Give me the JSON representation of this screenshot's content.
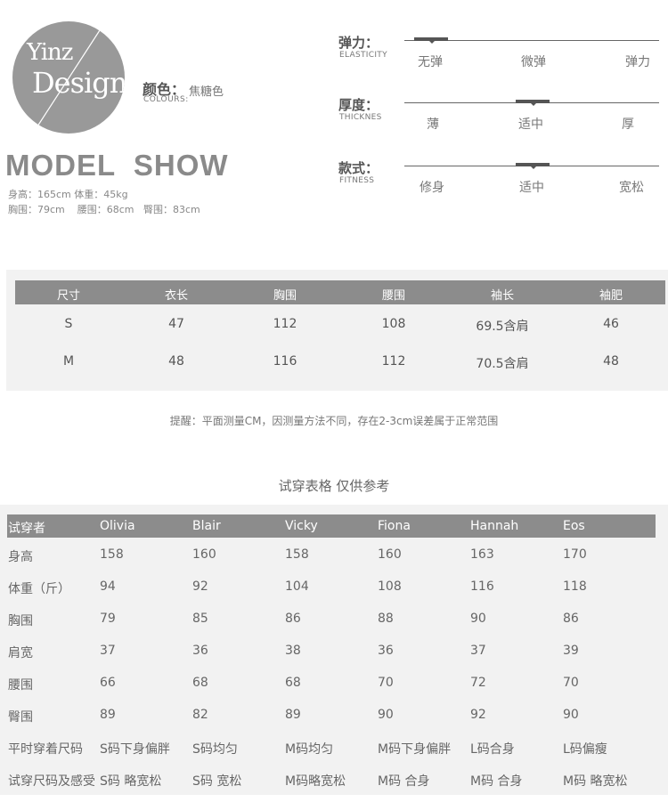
{
  "logo": {
    "line1": "Yinz",
    "line2": "Design"
  },
  "color": {
    "label": "颜色：",
    "value": "焦糖色",
    "label_en": "COLOURS:"
  },
  "model_show": {
    "title": "MODEL  SHOW",
    "line1": "身高：165cm 体重：45kg",
    "line2": "胸围：79cm    腰围：68cm   臀围：83cm"
  },
  "sliders": [
    {
      "label": "弹力：",
      "label_en": "ELASTICITY",
      "options": [
        "无弹",
        "微弹",
        "弹力"
      ],
      "selected": "无弹"
    },
    {
      "label": "厚度：",
      "label_en": "THICKNES",
      "options": [
        "薄",
        "适中",
        "厚"
      ],
      "selected": "适中"
    },
    {
      "label": "款式：",
      "label_en": "FITNESS",
      "options": [
        "修身",
        "适中",
        "宽松"
      ],
      "selected": "适中"
    }
  ],
  "size_table": {
    "headers": [
      "尺寸",
      "衣长",
      "胸围",
      "腰围",
      "袖长",
      "袖肥"
    ],
    "rows": [
      [
        "S",
        "47",
        "112",
        "108",
        "69.5含肩",
        "46"
      ],
      [
        "M",
        "48",
        "116",
        "112",
        "70.5含肩",
        "48"
      ]
    ]
  },
  "note": "提醒：平面测量CM，因测量方法不同，存在2-3cm误差属于正常范围",
  "trial_table": {
    "title": "试穿表格 仅供参考",
    "headers": [
      "试穿者",
      "Olivia",
      "Blair",
      "Vicky",
      "Fiona",
      "Hannah",
      "Eos"
    ],
    "rows": [
      [
        "身高",
        "158",
        "160",
        "158",
        "160",
        "163",
        "170"
      ],
      [
        "体重（斤）",
        "94",
        "92",
        "104",
        "108",
        "116",
        "118"
      ],
      [
        "胸围",
        "79",
        "85",
        "86",
        "88",
        "90",
        "86"
      ],
      [
        "肩宽",
        "37",
        "36",
        "38",
        "36",
        "37",
        "39"
      ],
      [
        "腰围",
        "66",
        "68",
        "68",
        "70",
        "72",
        "70"
      ],
      [
        "臀围",
        "89",
        "82",
        "89",
        "90",
        "92",
        "90"
      ],
      [
        "平时穿着尺码",
        "S码下身偏胖",
        "S码均匀",
        "M码均匀",
        "M码下身偏胖",
        "L码合身",
        "L码偏瘦"
      ],
      [
        "试穿尺码及感受",
        "S码 略宽松",
        "S码 宽松",
        "M码略宽松",
        "M码 合身",
        "M码 合身",
        "M码 略宽松"
      ]
    ]
  }
}
